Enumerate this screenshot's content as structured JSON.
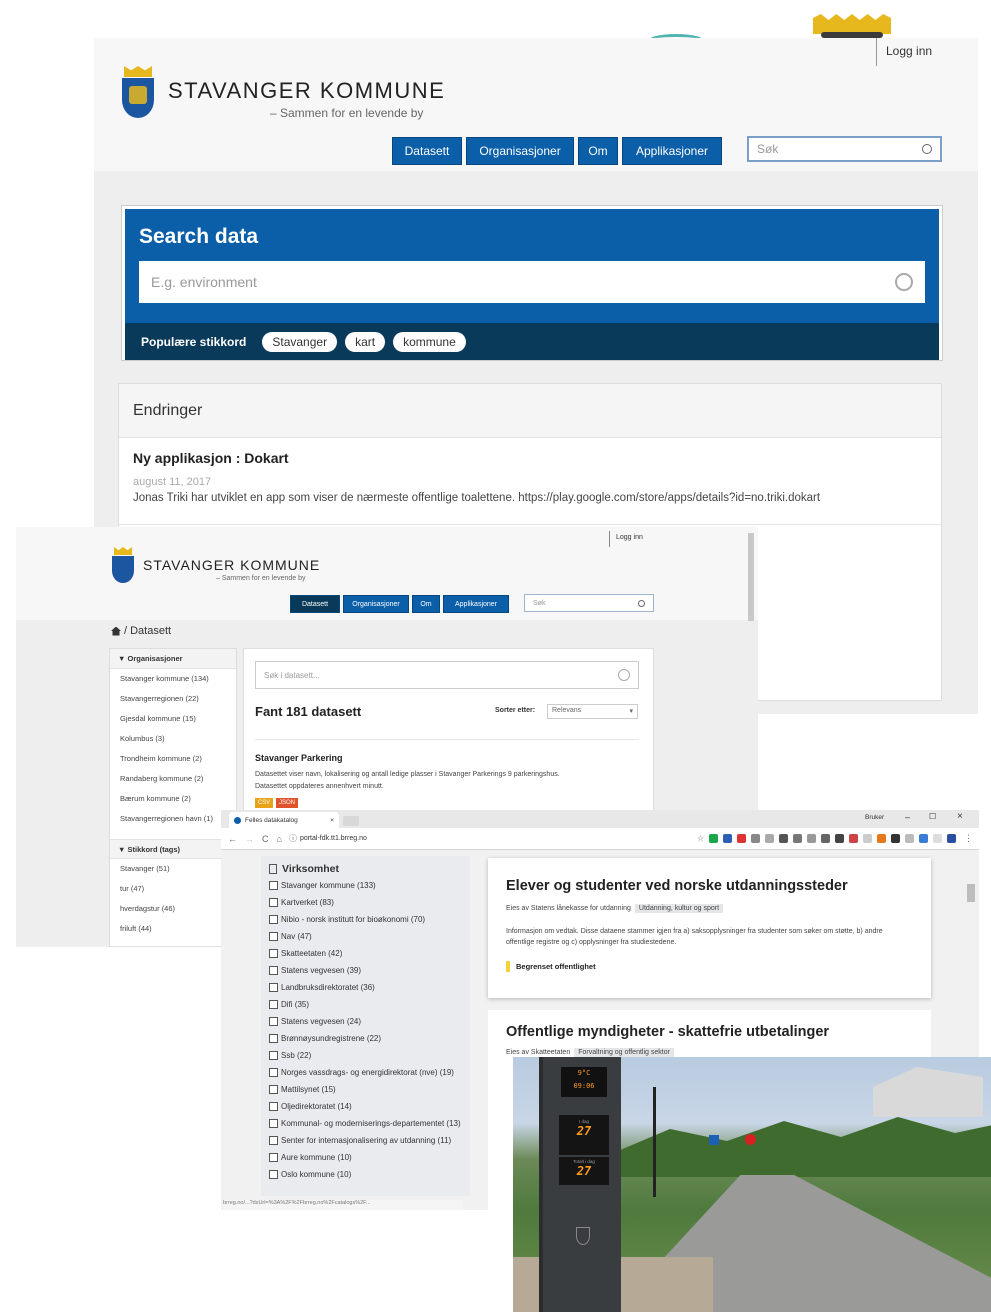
{
  "back": {
    "login": "Logg inn",
    "brand": "STAVANGER KOMMUNE",
    "tagline": "– Sammen for en levende by",
    "nav": [
      "Datasett",
      "Organisasjoner",
      "Om",
      "Applikasjoner"
    ],
    "search_placeholder": "Søk",
    "hero_title": "Search data",
    "hero_placeholder": "E.g. environment",
    "popular_label": "Populære stikkord",
    "popular_tags": [
      "Stavanger",
      "kart",
      "kommune"
    ],
    "changes_title": "Endringer",
    "change": {
      "title": "Ny applikasjon : Dokart",
      "date": "august 11, 2017",
      "text": "Jonas Triki har utviklet en app som viser de nærmeste offentlige toalettene. https://play.google.com/store/apps/details?id=no.triki.dokart"
    }
  },
  "middle": {
    "login": "Logg inn",
    "brand": "STAVANGER KOMMUNE",
    "tagline": "– Sammen for en levende by",
    "nav": [
      "Datasett",
      "Organisasjoner",
      "Om",
      "Applikasjoner"
    ],
    "search_placeholder": "Søk",
    "breadcrumb": "/ Datasett",
    "org_heading": "Organisasjoner",
    "orgs": [
      "Stavanger kommune (134)",
      "Stavangerregionen (22)",
      "Gjesdal kommune (15)",
      "Kolumbus (3)",
      "Trondheim kommune (2)",
      "Randaberg kommune (2)",
      "Bærum kommune (2)",
      "Stavangerregionen havn (1)"
    ],
    "tags_heading": "Stikkord (tags)",
    "tags": [
      "Stavanger (51)",
      "tur (47)",
      "hverdagstur (46)",
      "friluft (44)"
    ],
    "dataset_search_placeholder": "Søk i datasett...",
    "found": "Fant 181 datasett",
    "sort_label": "Sorter etter:",
    "sort_value": "Relevans",
    "result": {
      "title": "Stavanger Parkering",
      "text1": "Datasettet viser navn, lokalisering og antall ledige plasser i Stavanger Parkerings 9 parkeringshus.",
      "text2": "Datasettet oppdateres annenhvert minutt.",
      "formats": [
        "CSV",
        "JSON"
      ]
    }
  },
  "front": {
    "tab_title": "Felles datakatalog",
    "url": "portal-fdk.tt1.brreg.no",
    "user": "Bruker",
    "facet_heading": "Virksomhet",
    "facets": [
      "Stavanger kommune (133)",
      "Kartverket (83)",
      "Nibio - norsk institutt for bioøkonomi (70)",
      "Nav (47)",
      "Skatteetaten (42)",
      "Statens vegvesen (39)",
      "Landbruksdirektoratet (36)",
      "Difi (35)",
      "Statens vegvesen (24)",
      "Brønnøysundregistrene (22)",
      "Ssb (22)",
      "Norges vassdrags- og energidirektorat (nve) (19)",
      "Mattilsynet (15)",
      "Oljedirektoratet (14)",
      "Kommunal- og moderniserings-departementet (13)",
      "Senter for internasjonalisering av utdanning (11)",
      "Aure kommune (10)",
      "Oslo kommune (10)"
    ],
    "card1": {
      "title": "Elever og studenter ved norske utdanningssteder",
      "owner": "Eies av Statens lånekasse for utdanning",
      "theme": "Utdanning, kultur og sport",
      "text": "Informasjon om vedtak. Disse dataene stammer igjen fra a) saksopplysninger fra studenter som søker om støtte, b) andre offentlige registre og c) opplysninger fra studiestedene.",
      "access": "Begrenset offentlighet"
    },
    "card2": {
      "title": "Offentlige myndigheter - skattefrie utbetalinger",
      "owner": "Eies av Skatteetaten",
      "theme": "Forvaltning og offentlig sektor"
    },
    "status_url": "brreg.no/...?dsUrl=%3A%2F%2Fbrreg.no%2Fcatalogs%2F..."
  },
  "photo": {
    "temperature": "9°C",
    "time": "09:06",
    "count_today": "27",
    "count_total": "27",
    "label_today": "I dag",
    "label_total": "Totalt i dag"
  },
  "colors": {
    "primary_blue": "#0b5ea8",
    "hero_dark": "#0a3a5a",
    "crest_blue": "#1d56a0",
    "crest_gold": "#e6b81d",
    "csv_badge": "#e8a317",
    "json_badge": "#e0522a",
    "access_yellow": "#f3d33b"
  }
}
